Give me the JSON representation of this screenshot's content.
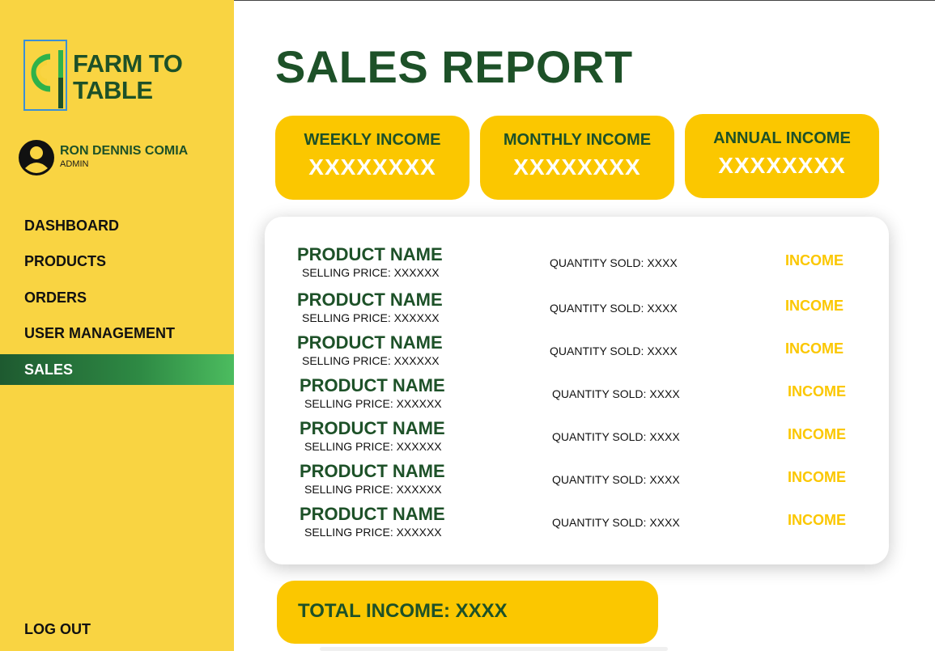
{
  "app": {
    "logo_text": "FARM TO TABLE",
    "brand_colors": {
      "green": "#1d5128",
      "yellow": "#fbc700",
      "sidebar": "#f9d442"
    }
  },
  "user": {
    "name": "RON DENNIS COMIA",
    "role": "ADMIN",
    "avatar_icon": "user-avatar-icon"
  },
  "sidebar": {
    "items": [
      {
        "label": "DASHBOARD",
        "active": false
      },
      {
        "label": "PRODUCTS",
        "active": false
      },
      {
        "label": "ORDERS",
        "active": false
      },
      {
        "label": "USER MANAGEMENT",
        "active": false
      },
      {
        "label": "SALES",
        "active": true
      }
    ],
    "logout_label": "LOG OUT"
  },
  "page": {
    "title": "SALES REPORT"
  },
  "summary_cards": [
    {
      "label": "WEEKLY INCOME",
      "value": "XXXXXXXX"
    },
    {
      "label": "MONTHLY INCOME",
      "value": "XXXXXXXX"
    },
    {
      "label": "ANNUAL INCOME",
      "value": "XXXXXXXX"
    }
  ],
  "products": [
    {
      "name": "PRODUCT NAME",
      "price": "SELLING PRICE: XXXXXX",
      "quantity": "QUANTITY SOLD: XXXX",
      "income": "INCOME"
    },
    {
      "name": "PRODUCT NAME",
      "price": "SELLING PRICE: XXXXXX",
      "quantity": "QUANTITY SOLD: XXXX",
      "income": "INCOME"
    },
    {
      "name": "PRODUCT NAME",
      "price": "SELLING PRICE: XXXXXX",
      "quantity": "QUANTITY SOLD: XXXX",
      "income": "INCOME"
    },
    {
      "name": "PRODUCT NAME",
      "price": "SELLING PRICE: XXXXXX",
      "quantity": "QUANTITY SOLD: XXXX",
      "income": "INCOME"
    },
    {
      "name": "PRODUCT NAME",
      "price": "SELLING PRICE: XXXXXX",
      "quantity": "QUANTITY SOLD: XXXX",
      "income": "INCOME"
    },
    {
      "name": "PRODUCT NAME",
      "price": "SELLING PRICE: XXXXXX",
      "quantity": "QUANTITY SOLD: XXXX",
      "income": "INCOME"
    },
    {
      "name": "PRODUCT NAME",
      "price": "SELLING PRICE: XXXXXX",
      "quantity": "QUANTITY SOLD: XXXX",
      "income": "INCOME"
    }
  ],
  "total": {
    "label": "TOTAL INCOME: XXXX"
  }
}
